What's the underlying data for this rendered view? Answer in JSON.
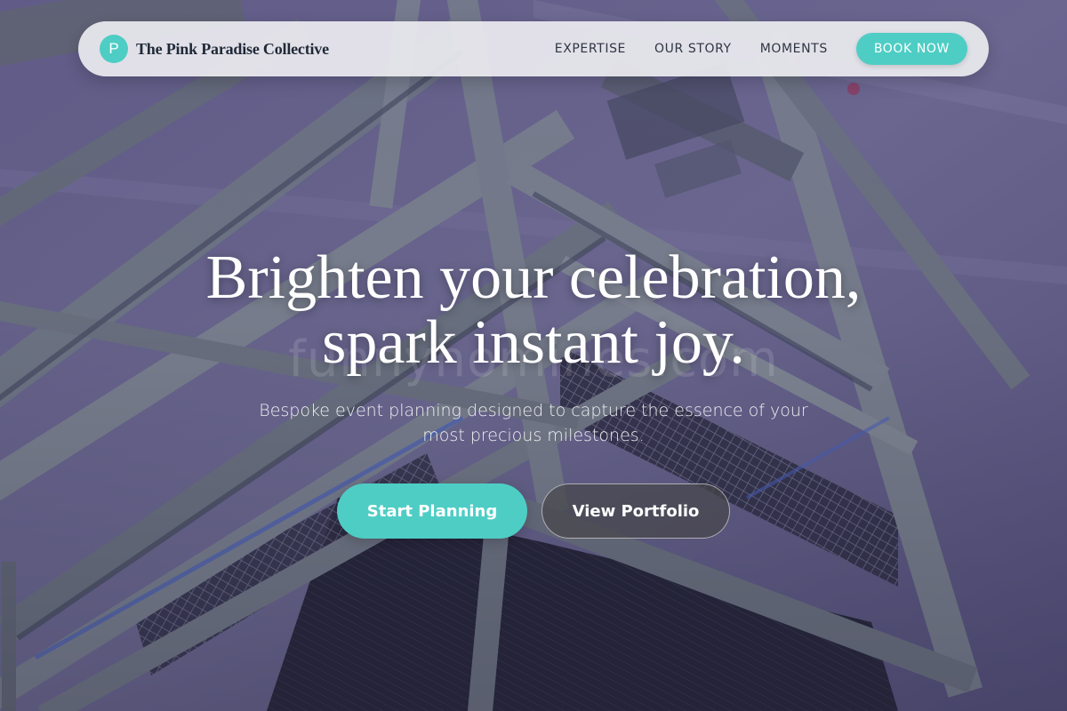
{
  "header": {
    "logo_letter": "P",
    "brand_name": "The Pink Paradise Collective",
    "nav": [
      {
        "label": "EXPERTISE"
      },
      {
        "label": "OUR STORY"
      },
      {
        "label": "MOMENTS"
      }
    ],
    "cta_label": "BOOK NOW"
  },
  "hero": {
    "title_line1": "Brighten your celebration,",
    "title_line2": "spark instant joy.",
    "subtitle_line1": "Bespoke event planning designed to capture the essence of your",
    "subtitle_line2": "most precious milestones.",
    "primary_cta": "Start Planning",
    "secondary_cta": "View Portfolio",
    "watermark": "funnyhomines.com"
  },
  "colors": {
    "accent": "#4ecdc4",
    "navbar_bg": "#ececf0",
    "text_dark": "#1f2937",
    "overlay": "#464073"
  }
}
